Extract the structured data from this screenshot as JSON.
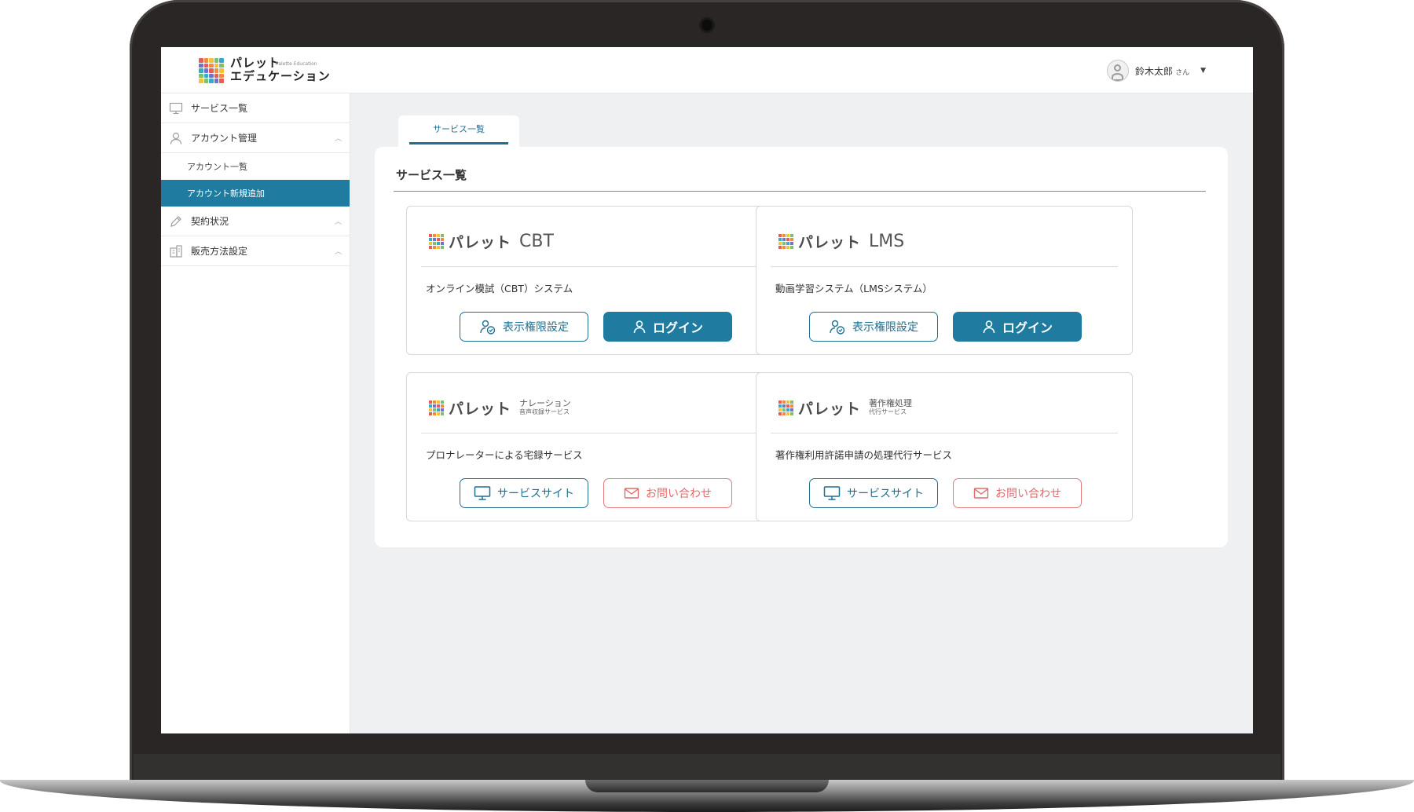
{
  "app": {
    "logo_title_line1": "パレット",
    "logo_title_line2": "エデュケーション",
    "logo_subtitle": "Palette Education"
  },
  "user": {
    "name": "鈴木太郎",
    "suffix": "さん"
  },
  "sidebar": {
    "items": [
      {
        "label": "サービス一覧",
        "icon": "monitor-icon"
      },
      {
        "label": "アカウント管理",
        "icon": "user-icon",
        "expanded": true,
        "children": [
          {
            "label": "アカウント一覧",
            "active": false
          },
          {
            "label": "アカウント新規追加",
            "active": true
          }
        ]
      },
      {
        "label": "契約状況",
        "icon": "pencil-icon"
      },
      {
        "label": "販売方法設定",
        "icon": "building-icon"
      }
    ]
  },
  "main": {
    "tab_label": "サービス一覧",
    "panel_title": "サービス一覧",
    "cards": [
      {
        "brand": "パレット",
        "product": "CBT",
        "description": "オンライン模試（CBT）システム",
        "buttons": [
          {
            "label": "表示権限設定",
            "icon": "user-settings-icon",
            "style": "outline-blue"
          },
          {
            "label": "ログイン",
            "icon": "user-icon",
            "style": "solid-blue"
          }
        ]
      },
      {
        "brand": "パレット",
        "product": "LMS",
        "description": "動画学習システム（LMSシステム）",
        "buttons": [
          {
            "label": "表示権限設定",
            "icon": "user-settings-icon",
            "style": "outline-blue"
          },
          {
            "label": "ログイン",
            "icon": "user-icon",
            "style": "solid-blue"
          }
        ]
      },
      {
        "brand": "パレット",
        "product_line1": "ナレーション",
        "product_line2": "音声収録サービス",
        "description": "プロナレーターによる宅録サービス",
        "buttons": [
          {
            "label": "サービスサイト",
            "icon": "monitor-icon",
            "style": "outline-blue"
          },
          {
            "label": "お問い合わせ",
            "icon": "mail-icon",
            "style": "outline-red"
          }
        ]
      },
      {
        "brand": "パレット",
        "product_line1": "著作権処理",
        "product_line2": "代行サービス",
        "description": "著作権利用許諾申請の処理代行サービス",
        "buttons": [
          {
            "label": "サービスサイト",
            "icon": "monitor-icon",
            "style": "outline-blue"
          },
          {
            "label": "お問い合わせ",
            "icon": "mail-icon",
            "style": "outline-red"
          }
        ]
      }
    ]
  },
  "colors": {
    "primary": "#1f7ba0",
    "primary_dark": "#1f6f92",
    "danger": "#e06b6b",
    "background": "#eef0f1"
  }
}
